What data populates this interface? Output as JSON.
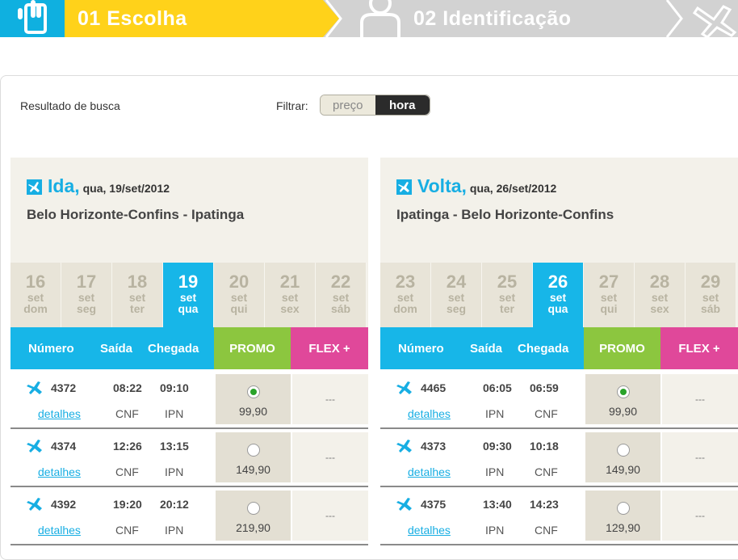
{
  "steps": [
    {
      "label": "01 Escolha"
    },
    {
      "label": "02 Identificação"
    }
  ],
  "result_label": "Resultado de busca",
  "filter": {
    "label": "Filtrar:",
    "options": [
      "preço",
      "hora"
    ],
    "selected": "hora"
  },
  "colors": {
    "accent_blue": "#17b6e8",
    "promo_green": "#8cc63f",
    "flex_pink": "#e0489a",
    "step_yellow": "#ffd21a"
  },
  "ida": {
    "title": "Ida,",
    "date": "qua, 19/set/2012",
    "route": "Belo Horizonte-Confins - Ipatinga",
    "days": [
      {
        "num": "16",
        "mon": "set",
        "wd": "dom"
      },
      {
        "num": "17",
        "mon": "set",
        "wd": "seg"
      },
      {
        "num": "18",
        "mon": "set",
        "wd": "ter"
      },
      {
        "num": "19",
        "mon": "set",
        "wd": "qua"
      },
      {
        "num": "20",
        "mon": "set",
        "wd": "qui"
      },
      {
        "num": "21",
        "mon": "set",
        "wd": "sex"
      },
      {
        "num": "22",
        "mon": "set",
        "wd": "sáb"
      }
    ],
    "selected_day": 3,
    "headers": {
      "numero": "Número",
      "saida": "Saída",
      "chegada": "Chegada",
      "promo": "PROMO",
      "flex": "FLEX +"
    },
    "flights": [
      {
        "number": "4372",
        "dep": "08:22",
        "arr": "09:10",
        "dep_code": "CNF",
        "arr_code": "IPN",
        "details": "detalhes",
        "promo_price": "99,90",
        "flex": "---",
        "selected": true
      },
      {
        "number": "4374",
        "dep": "12:26",
        "arr": "13:15",
        "dep_code": "CNF",
        "arr_code": "IPN",
        "details": "detalhes",
        "promo_price": "149,90",
        "flex": "---",
        "selected": false
      },
      {
        "number": "4392",
        "dep": "19:20",
        "arr": "20:12",
        "dep_code": "CNF",
        "arr_code": "IPN",
        "details": "detalhes",
        "promo_price": "219,90",
        "flex": "---",
        "selected": false
      }
    ]
  },
  "volta": {
    "title": "Volta,",
    "date": "qua, 26/set/2012",
    "route": "Ipatinga - Belo Horizonte-Confins",
    "days": [
      {
        "num": "23",
        "mon": "set",
        "wd": "dom"
      },
      {
        "num": "24",
        "mon": "set",
        "wd": "seg"
      },
      {
        "num": "25",
        "mon": "set",
        "wd": "ter"
      },
      {
        "num": "26",
        "mon": "set",
        "wd": "qua"
      },
      {
        "num": "27",
        "mon": "set",
        "wd": "qui"
      },
      {
        "num": "28",
        "mon": "set",
        "wd": "sex"
      },
      {
        "num": "29",
        "mon": "set",
        "wd": "sáb"
      }
    ],
    "selected_day": 3,
    "headers": {
      "numero": "Número",
      "saida": "Saída",
      "chegada": "Chegada",
      "promo": "PROMO",
      "flex": "FLEX +"
    },
    "flights": [
      {
        "number": "4465",
        "dep": "06:05",
        "arr": "06:59",
        "dep_code": "IPN",
        "arr_code": "CNF",
        "details": "detalhes",
        "promo_price": "99,90",
        "flex": "---",
        "selected": true
      },
      {
        "number": "4373",
        "dep": "09:30",
        "arr": "10:18",
        "dep_code": "IPN",
        "arr_code": "CNF",
        "details": "detalhes",
        "promo_price": "149,90",
        "flex": "---",
        "selected": false
      },
      {
        "number": "4375",
        "dep": "13:40",
        "arr": "14:23",
        "dep_code": "IPN",
        "arr_code": "CNF",
        "details": "detalhes",
        "promo_price": "129,90",
        "flex": "---",
        "selected": false
      }
    ]
  }
}
